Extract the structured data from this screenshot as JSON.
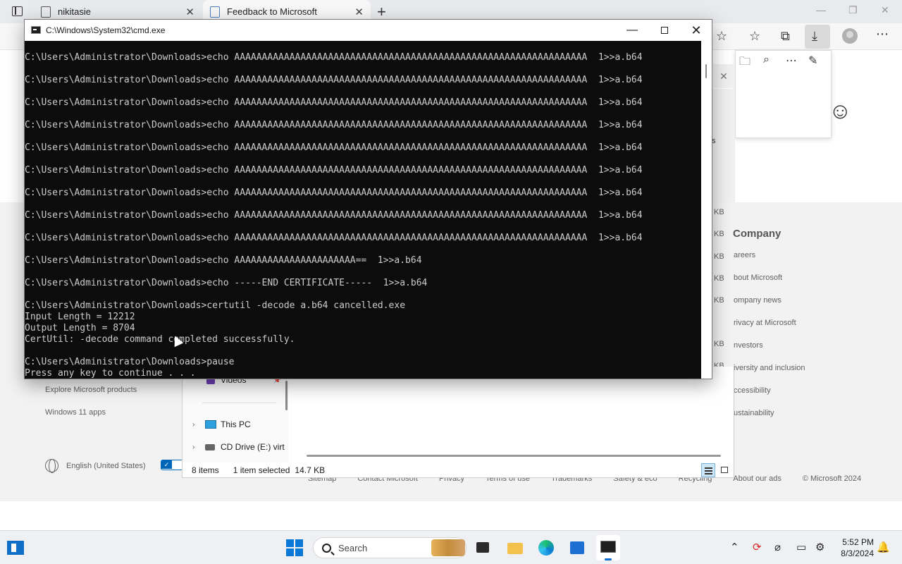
{
  "browser": {
    "tabs": [
      {
        "title": "nikitasie"
      },
      {
        "title": "Feedback to Microsoft"
      }
    ]
  },
  "page": {
    "footer": {
      "company_heading": "Company",
      "company_links": [
        "Careers",
        "About Microsoft",
        "Company news",
        "Privacy at Microsoft",
        "Investors",
        "Diversity and inclusion",
        "Accessibility",
        "Sustainability"
      ],
      "company_links_visible": [
        "areers",
        "bout Microsoft",
        "ompany news",
        "rivacy at Microsoft",
        "nvestors",
        "iversity and inclusion",
        "ccessibility",
        "ustainability"
      ],
      "left_links": [
        "Explore Microsoft products",
        "Windows 11 apps"
      ],
      "locale": "English (United States)",
      "bottom_links": [
        "Sitemap",
        "Contact Microsoft",
        "Privacy",
        "Terms of use",
        "Trademarks",
        "Safety & eco",
        "Recycling",
        "About our ads",
        "© Microsoft 2024"
      ],
      "kb_labels": [
        "KB",
        "KB",
        "KB",
        "KB",
        "KB",
        "KB",
        "KB"
      ]
    },
    "side_s": "s"
  },
  "explorer": {
    "nav": {
      "videos": "Videos",
      "this_pc": "This PC",
      "cd_drive": "CD Drive (E:) virt"
    },
    "status": {
      "item_count": "8 items",
      "selection": "1 item selected",
      "size": "14.7 KB"
    }
  },
  "cmd": {
    "title": "C:\\Windows\\System32\\cmd.exe",
    "lines": [
      "C:\\Users\\Administrator\\Downloads>echo AAAAAAAAAAAAAAAAAAAAAAAAAAAAAAAAAAAAAAAAAAAAAAAAAAAAAAAAAAAAAAAA  1>>a.b64",
      "",
      "C:\\Users\\Administrator\\Downloads>echo AAAAAAAAAAAAAAAAAAAAAAAAAAAAAAAAAAAAAAAAAAAAAAAAAAAAAAAAAAAAAAAA  1>>a.b64",
      "",
      "C:\\Users\\Administrator\\Downloads>echo AAAAAAAAAAAAAAAAAAAAAAAAAAAAAAAAAAAAAAAAAAAAAAAAAAAAAAAAAAAAAAAA  1>>a.b64",
      "",
      "C:\\Users\\Administrator\\Downloads>echo AAAAAAAAAAAAAAAAAAAAAAAAAAAAAAAAAAAAAAAAAAAAAAAAAAAAAAAAAAAAAAAA  1>>a.b64",
      "",
      "C:\\Users\\Administrator\\Downloads>echo AAAAAAAAAAAAAAAAAAAAAAAAAAAAAAAAAAAAAAAAAAAAAAAAAAAAAAAAAAAAAAAA  1>>a.b64",
      "",
      "C:\\Users\\Administrator\\Downloads>echo AAAAAAAAAAAAAAAAAAAAAAAAAAAAAAAAAAAAAAAAAAAAAAAAAAAAAAAAAAAAAAAA  1>>a.b64",
      "",
      "C:\\Users\\Administrator\\Downloads>echo AAAAAAAAAAAAAAAAAAAAAAAAAAAAAAAAAAAAAAAAAAAAAAAAAAAAAAAAAAAAAAAA  1>>a.b64",
      "",
      "C:\\Users\\Administrator\\Downloads>echo AAAAAAAAAAAAAAAAAAAAAAAAAAAAAAAAAAAAAAAAAAAAAAAAAAAAAAAAAAAAAAAA  1>>a.b64",
      "",
      "C:\\Users\\Administrator\\Downloads>echo AAAAAAAAAAAAAAAAAAAAAAAAAAAAAAAAAAAAAAAAAAAAAAAAAAAAAAAAAAAAAAAA  1>>a.b64",
      "",
      "C:\\Users\\Administrator\\Downloads>echo AAAAAAAAAAAAAAAAAAAAAA==  1>>a.b64",
      "",
      "C:\\Users\\Administrator\\Downloads>echo -----END CERTIFICATE-----  1>>a.b64",
      "",
      "C:\\Users\\Administrator\\Downloads>certutil -decode a.b64 cancelled.exe",
      "Input Length = 12212",
      "Output Length = 8704",
      "CertUtil: -decode command completed successfully.",
      "",
      "C:\\Users\\Administrator\\Downloads>pause",
      "Press any key to continue . . ."
    ]
  },
  "taskbar": {
    "search_label": "Search",
    "time": "5:52 PM",
    "date": "8/3/2024"
  }
}
